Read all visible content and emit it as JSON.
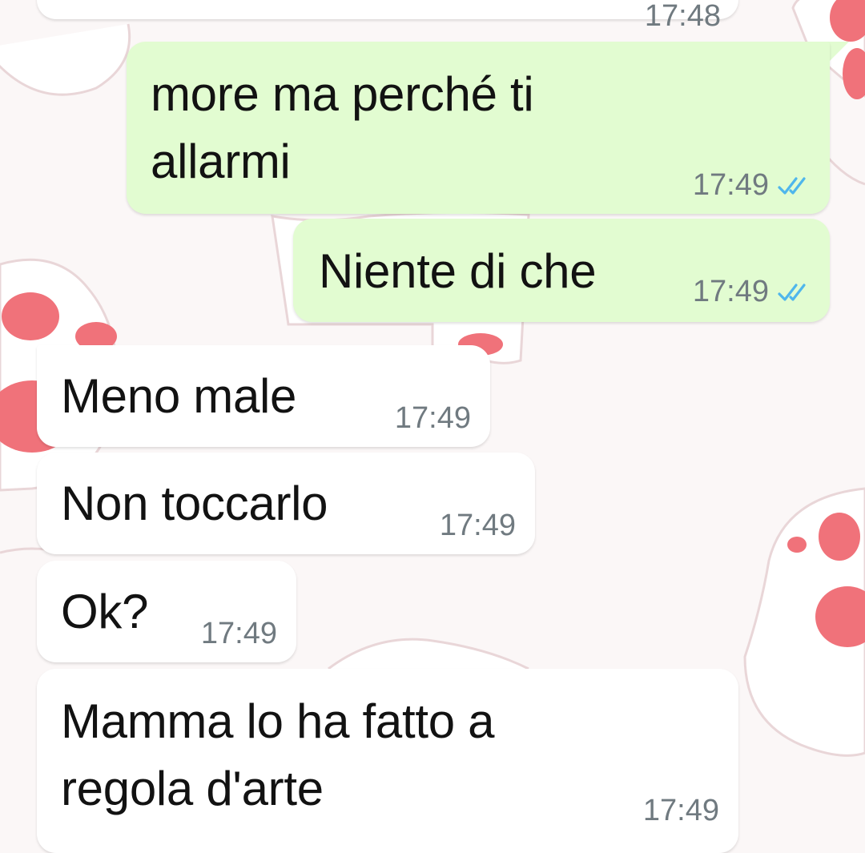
{
  "chat": {
    "wallpaper_icon": "cat-paw-icon",
    "colors": {
      "outgoing_bubble": "#e2fcd1",
      "incoming_bubble": "#ffffff",
      "read_ticks": "#4fb6ec",
      "timestamp": "#707a80",
      "paw_pad": "#f0727a"
    },
    "messages": [
      {
        "direction": "incoming",
        "lines": [
          ""
        ],
        "time": "17:48",
        "partial": true
      },
      {
        "direction": "outgoing",
        "lines": [
          "more ma perché ti",
          "allarmi"
        ],
        "time": "17:49",
        "status": "read"
      },
      {
        "direction": "outgoing",
        "lines": [
          "Niente di che"
        ],
        "time": "17:49",
        "status": "read"
      },
      {
        "direction": "incoming",
        "lines": [
          "Meno male"
        ],
        "time": "17:49"
      },
      {
        "direction": "incoming",
        "lines": [
          "Non toccarlo"
        ],
        "time": "17:49"
      },
      {
        "direction": "incoming",
        "lines": [
          "Ok?"
        ],
        "time": "17:49"
      },
      {
        "direction": "incoming",
        "lines": [
          "Mamma lo ha fatto a",
          "regola d'arte"
        ],
        "time": "17:49"
      }
    ]
  }
}
